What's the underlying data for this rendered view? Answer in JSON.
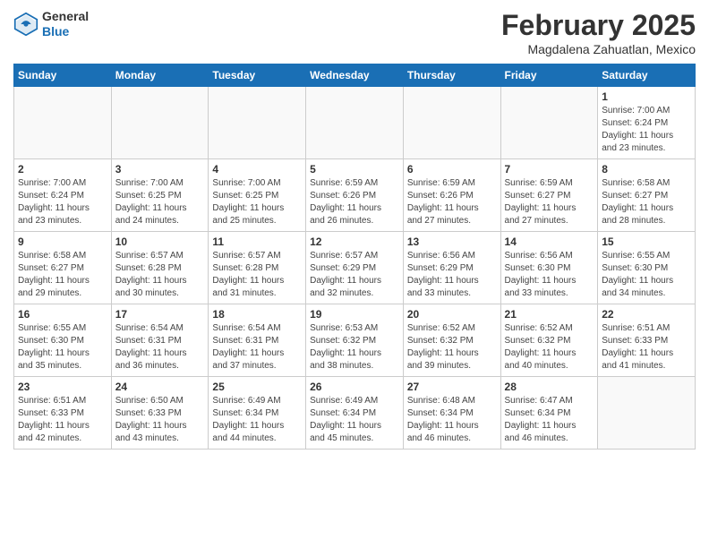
{
  "header": {
    "logo_general": "General",
    "logo_blue": "Blue",
    "month_title": "February 2025",
    "location": "Magdalena Zahuatlan, Mexico"
  },
  "weekdays": [
    "Sunday",
    "Monday",
    "Tuesday",
    "Wednesday",
    "Thursday",
    "Friday",
    "Saturday"
  ],
  "weeks": [
    [
      {
        "day": "",
        "info": ""
      },
      {
        "day": "",
        "info": ""
      },
      {
        "day": "",
        "info": ""
      },
      {
        "day": "",
        "info": ""
      },
      {
        "day": "",
        "info": ""
      },
      {
        "day": "",
        "info": ""
      },
      {
        "day": "1",
        "info": "Sunrise: 7:00 AM\nSunset: 6:24 PM\nDaylight: 11 hours\nand 23 minutes."
      }
    ],
    [
      {
        "day": "2",
        "info": "Sunrise: 7:00 AM\nSunset: 6:24 PM\nDaylight: 11 hours\nand 23 minutes."
      },
      {
        "day": "3",
        "info": "Sunrise: 7:00 AM\nSunset: 6:25 PM\nDaylight: 11 hours\nand 24 minutes."
      },
      {
        "day": "4",
        "info": "Sunrise: 7:00 AM\nSunset: 6:25 PM\nDaylight: 11 hours\nand 25 minutes."
      },
      {
        "day": "5",
        "info": "Sunrise: 6:59 AM\nSunset: 6:26 PM\nDaylight: 11 hours\nand 26 minutes."
      },
      {
        "day": "6",
        "info": "Sunrise: 6:59 AM\nSunset: 6:26 PM\nDaylight: 11 hours\nand 27 minutes."
      },
      {
        "day": "7",
        "info": "Sunrise: 6:59 AM\nSunset: 6:27 PM\nDaylight: 11 hours\nand 27 minutes."
      },
      {
        "day": "8",
        "info": "Sunrise: 6:58 AM\nSunset: 6:27 PM\nDaylight: 11 hours\nand 28 minutes."
      }
    ],
    [
      {
        "day": "9",
        "info": "Sunrise: 6:58 AM\nSunset: 6:27 PM\nDaylight: 11 hours\nand 29 minutes."
      },
      {
        "day": "10",
        "info": "Sunrise: 6:57 AM\nSunset: 6:28 PM\nDaylight: 11 hours\nand 30 minutes."
      },
      {
        "day": "11",
        "info": "Sunrise: 6:57 AM\nSunset: 6:28 PM\nDaylight: 11 hours\nand 31 minutes."
      },
      {
        "day": "12",
        "info": "Sunrise: 6:57 AM\nSunset: 6:29 PM\nDaylight: 11 hours\nand 32 minutes."
      },
      {
        "day": "13",
        "info": "Sunrise: 6:56 AM\nSunset: 6:29 PM\nDaylight: 11 hours\nand 33 minutes."
      },
      {
        "day": "14",
        "info": "Sunrise: 6:56 AM\nSunset: 6:30 PM\nDaylight: 11 hours\nand 33 minutes."
      },
      {
        "day": "15",
        "info": "Sunrise: 6:55 AM\nSunset: 6:30 PM\nDaylight: 11 hours\nand 34 minutes."
      }
    ],
    [
      {
        "day": "16",
        "info": "Sunrise: 6:55 AM\nSunset: 6:30 PM\nDaylight: 11 hours\nand 35 minutes."
      },
      {
        "day": "17",
        "info": "Sunrise: 6:54 AM\nSunset: 6:31 PM\nDaylight: 11 hours\nand 36 minutes."
      },
      {
        "day": "18",
        "info": "Sunrise: 6:54 AM\nSunset: 6:31 PM\nDaylight: 11 hours\nand 37 minutes."
      },
      {
        "day": "19",
        "info": "Sunrise: 6:53 AM\nSunset: 6:32 PM\nDaylight: 11 hours\nand 38 minutes."
      },
      {
        "day": "20",
        "info": "Sunrise: 6:52 AM\nSunset: 6:32 PM\nDaylight: 11 hours\nand 39 minutes."
      },
      {
        "day": "21",
        "info": "Sunrise: 6:52 AM\nSunset: 6:32 PM\nDaylight: 11 hours\nand 40 minutes."
      },
      {
        "day": "22",
        "info": "Sunrise: 6:51 AM\nSunset: 6:33 PM\nDaylight: 11 hours\nand 41 minutes."
      }
    ],
    [
      {
        "day": "23",
        "info": "Sunrise: 6:51 AM\nSunset: 6:33 PM\nDaylight: 11 hours\nand 42 minutes."
      },
      {
        "day": "24",
        "info": "Sunrise: 6:50 AM\nSunset: 6:33 PM\nDaylight: 11 hours\nand 43 minutes."
      },
      {
        "day": "25",
        "info": "Sunrise: 6:49 AM\nSunset: 6:34 PM\nDaylight: 11 hours\nand 44 minutes."
      },
      {
        "day": "26",
        "info": "Sunrise: 6:49 AM\nSunset: 6:34 PM\nDaylight: 11 hours\nand 45 minutes."
      },
      {
        "day": "27",
        "info": "Sunrise: 6:48 AM\nSunset: 6:34 PM\nDaylight: 11 hours\nand 46 minutes."
      },
      {
        "day": "28",
        "info": "Sunrise: 6:47 AM\nSunset: 6:34 PM\nDaylight: 11 hours\nand 46 minutes."
      },
      {
        "day": "",
        "info": ""
      }
    ]
  ]
}
